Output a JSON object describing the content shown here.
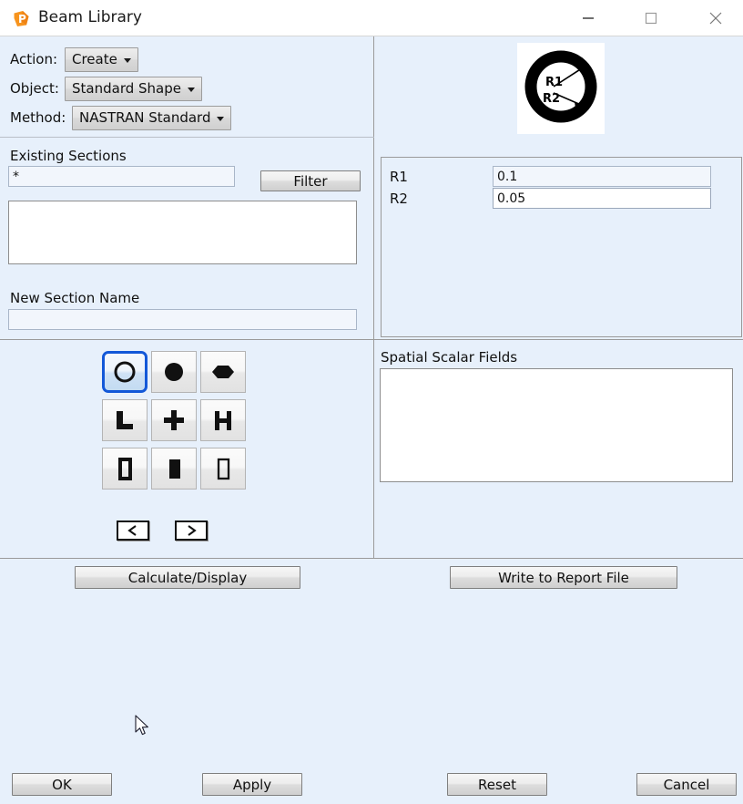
{
  "window": {
    "title": "Beam Library",
    "app_icon": "patran-p-icon",
    "icon_color": "#f59322",
    "controls": {
      "minimize": "minimize-icon",
      "maximize": "maximize-icon",
      "close": "close-icon"
    }
  },
  "form": {
    "action": {
      "label": "Action:",
      "value": "Create"
    },
    "object": {
      "label": "Object:",
      "value": "Standard Shape"
    },
    "method": {
      "label": "Method:",
      "value": "NASTRAN Standard"
    }
  },
  "existing_sections": {
    "label": "Existing Sections",
    "filter_value": "*",
    "filter_placeholder": "",
    "filter_button": "Filter",
    "list_items": []
  },
  "new_section": {
    "label": "New Section Name",
    "value": "",
    "placeholder": ""
  },
  "shape_grid": {
    "selected_index": 0,
    "shapes": [
      {
        "name": "hollow-circle-tube-shape",
        "glyph": "circle-outline"
      },
      {
        "name": "solid-circle-rod-shape",
        "glyph": "circle-filled"
      },
      {
        "name": "hexagon-shape",
        "glyph": "hexagon-filled"
      },
      {
        "name": "angle-l-shape",
        "glyph": "l-angle"
      },
      {
        "name": "cross-shape",
        "glyph": "plus-cross"
      },
      {
        "name": "i-beam-h-shape",
        "glyph": "h-beam"
      },
      {
        "name": "hollow-rectangle-tube-shape",
        "glyph": "rect-outline-thick"
      },
      {
        "name": "solid-rectangle-bar-shape",
        "glyph": "rect-filled"
      },
      {
        "name": "hollow-rectangle-thin-shape",
        "glyph": "rect-outline-thin"
      }
    ],
    "prev_button": "<",
    "next_button": ">"
  },
  "preview": {
    "name": "beam-cross-section-preview",
    "shape": "hollow-circular-tube",
    "annotations": [
      "R1",
      "R2"
    ]
  },
  "parameters": {
    "rows": [
      {
        "label": "R1",
        "value": "0.1",
        "focused": false
      },
      {
        "label": "R2",
        "value": "0.05",
        "focused": true
      }
    ]
  },
  "spatial_scalar_fields": {
    "label": "Spatial Scalar Fields",
    "items": []
  },
  "actions": {
    "calculate_display": "Calculate/Display",
    "write_report": "Write to Report File"
  },
  "footer": {
    "ok": "OK",
    "apply": "Apply",
    "reset": "Reset",
    "cancel": "Cancel"
  },
  "colors": {
    "window_background": "#e7f0fb",
    "titlebar": "#ffffff",
    "selection_blue": "#1358d8",
    "field_background": "#f2f6fc",
    "divider": "#9a9a9a"
  }
}
